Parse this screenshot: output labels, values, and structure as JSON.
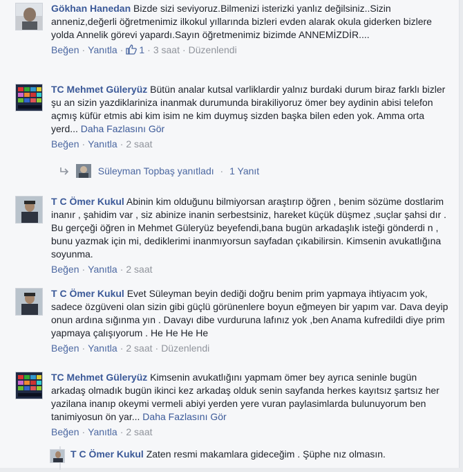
{
  "comments": [
    {
      "name": "Gökhan Hanedan",
      "text": "Bizde sizi seviyoruz.Bilmenizi isterizki yanlız değilsiniz..Sizin anneniz,değerli öğretmenimiz ilkokul yıllarında bizleri evden alarak okula giderken bizlere yolda Annelik görevi yapardı.Sayın öğretmenimiz bizimde ANNEMİZDİR....",
      "like_label": "Beğen",
      "reply_label": "Yanıtla",
      "likes": "1",
      "time": "3 saat",
      "edited": "Düzenlendi"
    },
    {
      "name": "TC Mehmet Güleryüz",
      "text": "Bütün analar kutsal varliklardir yalnız burdaki durum biraz farklı bizler şu an sizin yazdiklariniza inanmak durumunda birakiliyoruz ömer bey aydinin abisi telefon açmış küfür etmis abi kim isim ne kim duymuş sizden başka bilen eden yok. Amma orta yerd...",
      "more": "Daha Fazlasını Gör",
      "like_label": "Beğen",
      "reply_label": "Yanıtla",
      "time": "2 saat"
    },
    {
      "name": "T C Ömer Kukul",
      "text": "Abinin kim olduğunu bilmiyorsan araştırıp öğren , benim sözüme dostlarim inanır , şahidim var , siz abinize inanin serbestsiniz, hareket küçük düşmez ,suçlar şahsi dır . Bu gerçeği öğren in Mehmet Güleryüz beyefendi,bana bugün arkadaşlık isteği gönderdi n , bunu yazmak için mi, dediklerimi inanmıyorsun sayfadan çıkabilirsin. Kimsenin avukatlığına soyunma.",
      "like_label": "Beğen",
      "reply_label": "Yanıtla",
      "time": "2 saat"
    },
    {
      "name": "T C Ömer Kukul",
      "text": "Evet Süleyman beyin dediği doğru benim prim yapmaya ihtiyacım yok, sadece özgüveni olan sizin gibi güçlü görünenlere boyun eğmeyen bir yapım var. Dava deyip onun ardına sığınma yın . Davayı dibe vurduruna lafınız yok ,ben Anama kufredildi diye prim yapmaya çalışıyorum . He He He He",
      "like_label": "Beğen",
      "reply_label": "Yanıtla",
      "time": "2 saat",
      "edited": "Düzenlendi"
    },
    {
      "name": "TC Mehmet Güleryüz",
      "text": "Kimsenin avukatlığını yapmam ömer bey ayrıca seninle bugün arkadaş olmadık bugün ikinci kez arkadaş olduk senin sayfanda herkes kayıtsız şartsız her yazilana inanıp okeymi vermeli abiyi yerden yere vuran paylasimlarda bulunuyorum ben tanimiyosun ön yar...",
      "more": "Daha Fazlasını Gör",
      "like_label": "Beğen",
      "reply_label": "Yanıtla",
      "time": "2 saat"
    }
  ],
  "reply_summary": {
    "text": "Süleyman Topbaş yanıtladı",
    "count": "1 Yanıt"
  },
  "nested_reply": {
    "name": "T C Ömer Kukul",
    "text": "Zaten resmi makamlara gideceğim . Şüphe nız olmasın."
  },
  "colors": {
    "link": "#3b5998",
    "meta": "#90949c",
    "background": "#f6f7f9"
  },
  "icons": [
    "thumbs-up-icon",
    "reply-arrow-icon"
  ]
}
